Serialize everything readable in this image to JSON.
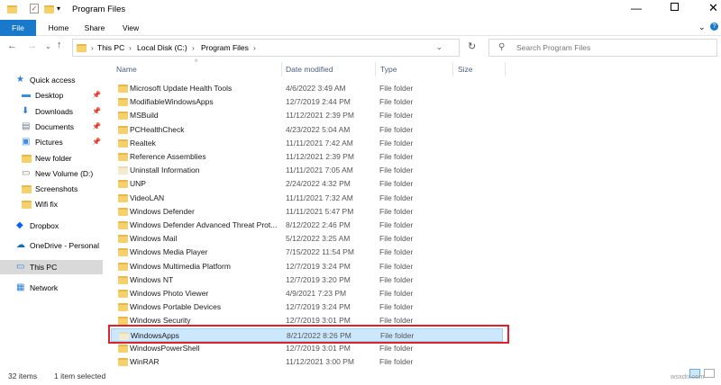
{
  "window": {
    "title": "Program Files",
    "controls": [
      "minimize",
      "maximize",
      "close"
    ]
  },
  "ribbon": {
    "tabs": [
      "File",
      "Home",
      "Share",
      "View"
    ],
    "accent": "#1979ca"
  },
  "address": {
    "crumbs": [
      "This PC",
      "Local Disk (C:)",
      "Program Files"
    ]
  },
  "search": {
    "placeholder": "Search Program Files"
  },
  "sidebar": {
    "items": [
      {
        "label": "Quick access",
        "icon": "star-icon",
        "pinned": false
      },
      {
        "label": "Desktop",
        "icon": "desktop-icon",
        "pinned": true
      },
      {
        "label": "Downloads",
        "icon": "download-icon",
        "pinned": true
      },
      {
        "label": "Documents",
        "icon": "document-icon",
        "pinned": true
      },
      {
        "label": "Pictures",
        "icon": "picture-icon",
        "pinned": true
      },
      {
        "label": "New folder",
        "icon": "folder-icon",
        "pinned": false
      },
      {
        "label": "New Volume (D:)",
        "icon": "drive-icon",
        "pinned": false
      },
      {
        "label": "Screenshots",
        "icon": "folder-icon",
        "pinned": false
      },
      {
        "label": "Wifi fix",
        "icon": "folder-icon",
        "pinned": false
      },
      {
        "label": "Dropbox",
        "icon": "dropbox-icon",
        "pinned": false
      },
      {
        "label": "OneDrive - Personal",
        "icon": "cloud-icon",
        "pinned": false
      },
      {
        "label": "This PC",
        "icon": "computer-icon",
        "pinned": false,
        "selected": true
      },
      {
        "label": "Network",
        "icon": "network-icon",
        "pinned": false
      }
    ]
  },
  "columns": [
    "Name",
    "Date modified",
    "Type",
    "Size"
  ],
  "files": [
    {
      "name": "Microsoft Update Health Tools",
      "date": "4/6/2022 3:49 AM",
      "type": "File folder"
    },
    {
      "name": "ModifiableWindowsApps",
      "date": "12/7/2019 2:44 PM",
      "type": "File folder"
    },
    {
      "name": "MSBuild",
      "date": "11/12/2021 2:39 PM",
      "type": "File folder"
    },
    {
      "name": "PCHealthCheck",
      "date": "4/23/2022 5:04 AM",
      "type": "File folder"
    },
    {
      "name": "Realtek",
      "date": "11/11/2021 7:42 AM",
      "type": "File folder"
    },
    {
      "name": "Reference Assemblies",
      "date": "11/12/2021 2:39 PM",
      "type": "File folder"
    },
    {
      "name": "Uninstall Information",
      "date": "11/11/2021 7:05 AM",
      "type": "File folder",
      "faded": true
    },
    {
      "name": "UNP",
      "date": "2/24/2022 4:32 PM",
      "type": "File folder"
    },
    {
      "name": "VideoLAN",
      "date": "11/11/2021 7:32 AM",
      "type": "File folder"
    },
    {
      "name": "Windows Defender",
      "date": "11/11/2021 5:47 PM",
      "type": "File folder"
    },
    {
      "name": "Windows Defender Advanced Threat Prot...",
      "date": "8/12/2022 2:46 PM",
      "type": "File folder"
    },
    {
      "name": "Windows Mail",
      "date": "5/12/2022 3:25 AM",
      "type": "File folder"
    },
    {
      "name": "Windows Media Player",
      "date": "7/15/2022 11:54 PM",
      "type": "File folder"
    },
    {
      "name": "Windows Multimedia Platform",
      "date": "12/7/2019 3:24 PM",
      "type": "File folder"
    },
    {
      "name": "Windows NT",
      "date": "12/7/2019 3:20 PM",
      "type": "File folder"
    },
    {
      "name": "Windows Photo Viewer",
      "date": "4/9/2021 7:23 PM",
      "type": "File folder"
    },
    {
      "name": "Windows Portable Devices",
      "date": "12/7/2019 3:24 PM",
      "type": "File folder"
    },
    {
      "name": "Windows Security",
      "date": "12/7/2019 3:01 PM",
      "type": "File folder"
    },
    {
      "name": "WindowsApps",
      "date": "8/21/2022 8:26 PM",
      "type": "File folder",
      "selected": true,
      "faded": true
    },
    {
      "name": "WindowsPowerShell",
      "date": "12/7/2019 3:01 PM",
      "type": "File folder"
    },
    {
      "name": "WinRAR",
      "date": "11/12/2021 3:00 PM",
      "type": "File folder"
    }
  ],
  "highlight_color": "#e0212b",
  "status": {
    "count": "32 items",
    "selected": "1 item selected"
  },
  "watermark": "wsxdn.com"
}
